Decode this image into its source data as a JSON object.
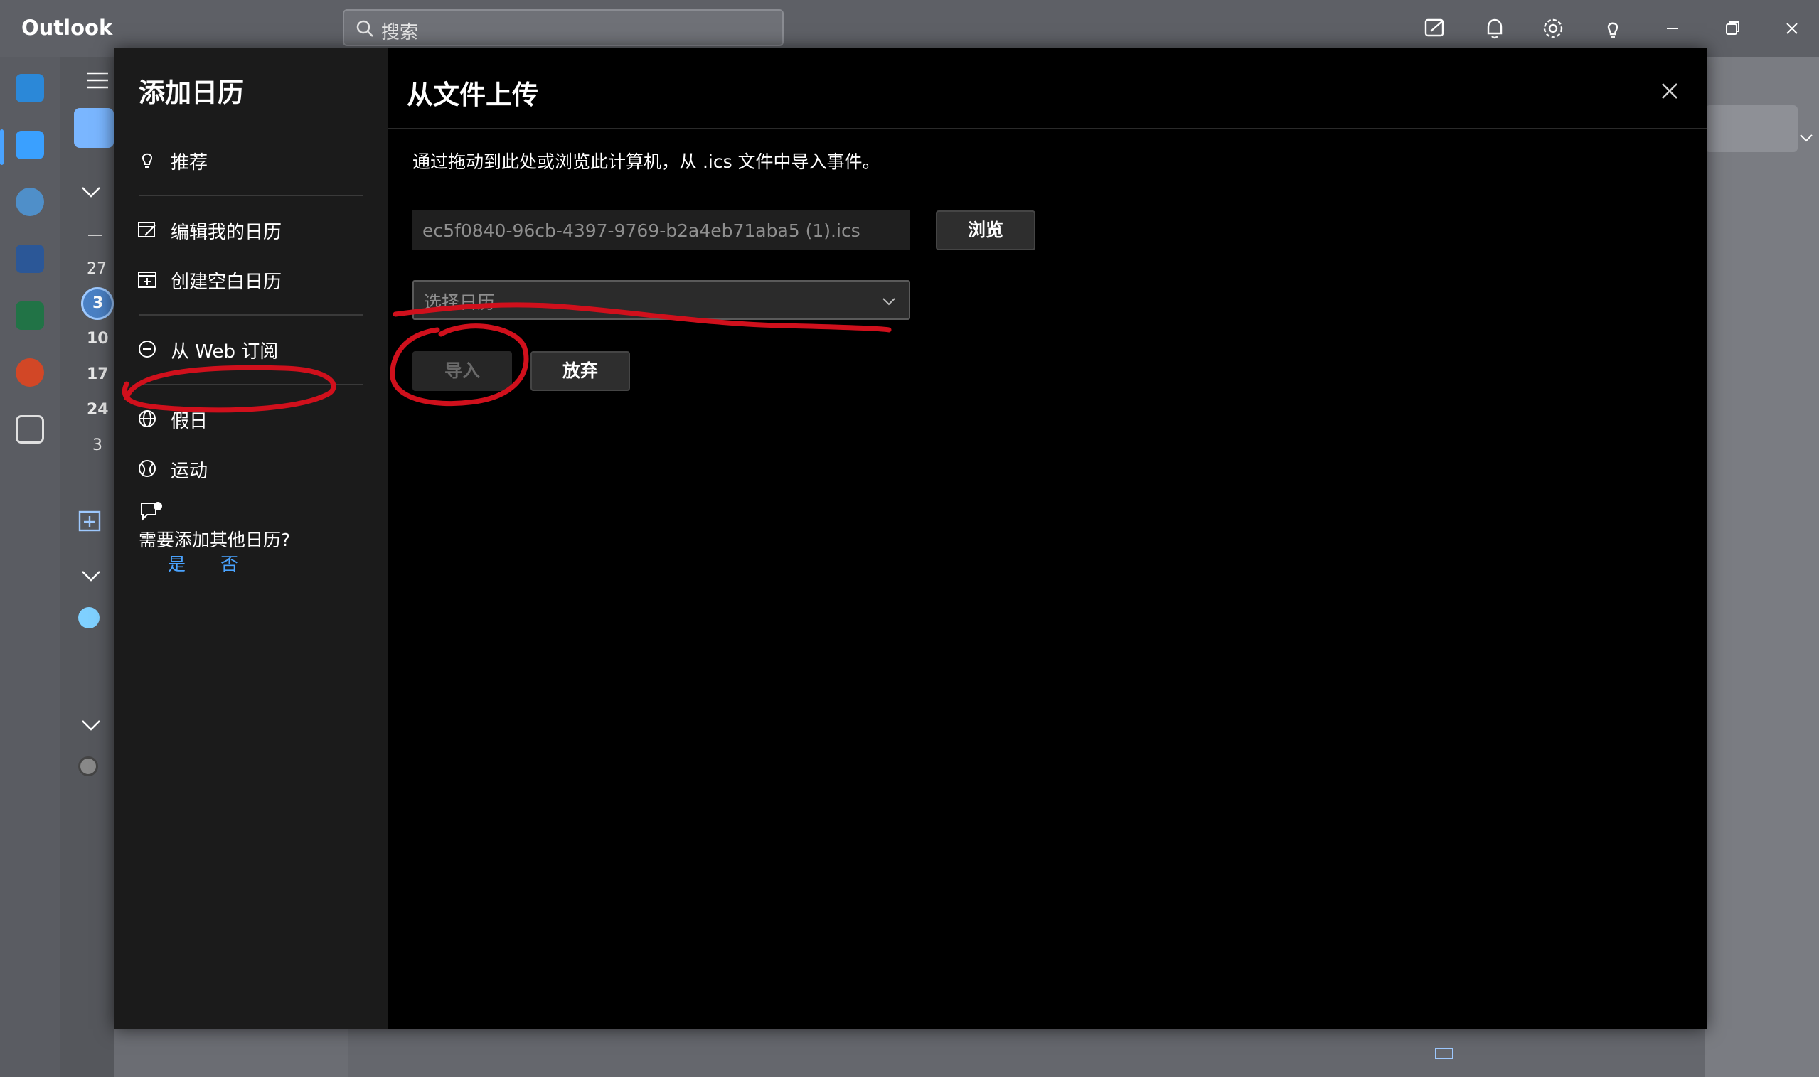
{
  "window": {
    "app_title": "Outlook",
    "search_placeholder": "搜索"
  },
  "calendar_nav": {
    "dates": [
      "27",
      "3",
      "10",
      "17",
      "24",
      "3"
    ],
    "selected_date": "3"
  },
  "dialog": {
    "left_title": "添加日历",
    "menu": [
      {
        "label": "推荐",
        "icon": "lightbulb-icon"
      },
      {
        "label": "编辑我的日历",
        "icon": "edit-calendar-icon"
      },
      {
        "label": "创建空白日历",
        "icon": "add-calendar-icon"
      },
      {
        "label": "从 Web 订阅",
        "icon": "link-icon"
      },
      {
        "label": "假日",
        "icon": "globe-icon"
      },
      {
        "label": "运动",
        "icon": "basketball-icon"
      }
    ],
    "feedback": {
      "question": "需要添加其他日历?",
      "yes": "是",
      "no": "否"
    },
    "title": "从文件上传",
    "instruction": "通过拖动到此处或浏览此计算机，从 .ics 文件中导入事件。",
    "file_name": "ec5f0840-96cb-4397-9769-b2a4eb71aba5 (1).ics",
    "browse_label": "浏览",
    "calendar_select_placeholder": "选择日历",
    "import_label": "导入",
    "discard_label": "放弃"
  },
  "colors": {
    "dialog_bg": "#000000",
    "sidebar_bg": "#1b1b1b",
    "link": "#4aa3ff",
    "annotation": "#d0101c"
  }
}
